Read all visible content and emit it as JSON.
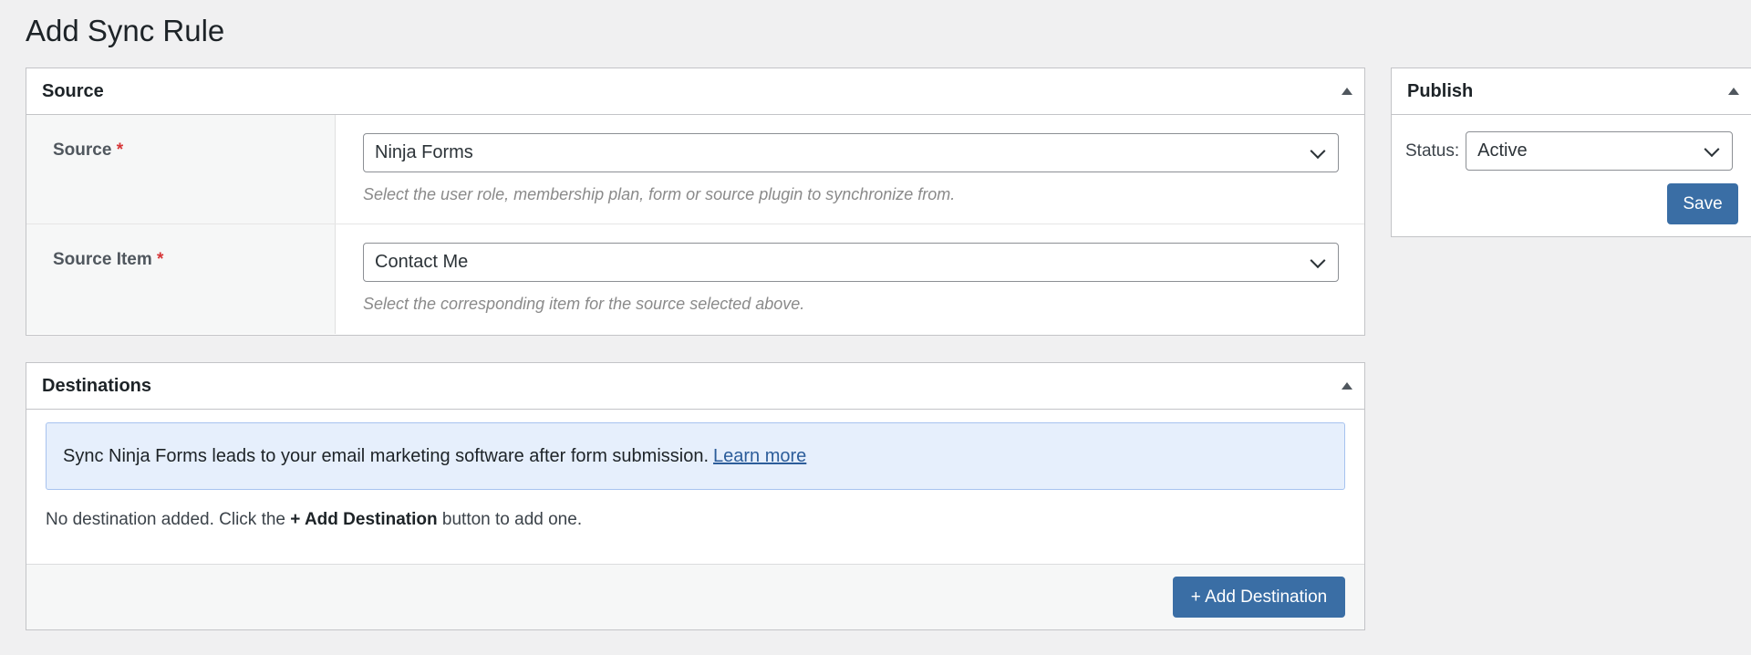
{
  "page": {
    "title": "Add Sync Rule"
  },
  "source_box": {
    "title": "Source",
    "fields": [
      {
        "label": "Source",
        "required_mark": "*",
        "value": "Ninja Forms",
        "help": "Select the user role, membership plan, form or source plugin to synchronize from."
      },
      {
        "label": "Source Item",
        "required_mark": "*",
        "value": "Contact Me",
        "help": "Select the corresponding item for the source selected above."
      }
    ]
  },
  "destinations_box": {
    "title": "Destinations",
    "notice_text": "Sync Ninja Forms leads to your email marketing software after form submission.",
    "notice_link": "Learn more",
    "empty_prefix": "No destination added. Click the",
    "empty_bold": "+ Add Destination",
    "empty_suffix": "button to add one.",
    "add_button": "+ Add Destination"
  },
  "publish_box": {
    "title": "Publish",
    "status_label": "Status:",
    "status_value": "Active",
    "save_button": "Save"
  },
  "colors": {
    "background": "#f0f0f1",
    "primary_button": "#3a6ea5",
    "required": "#d63638",
    "notice_bg": "#e6effc",
    "notice_border": "#a7c3ef",
    "link": "#2c5d9a"
  },
  "icons": [
    "collapse-arrow-icon",
    "chevron-down-icon"
  ]
}
